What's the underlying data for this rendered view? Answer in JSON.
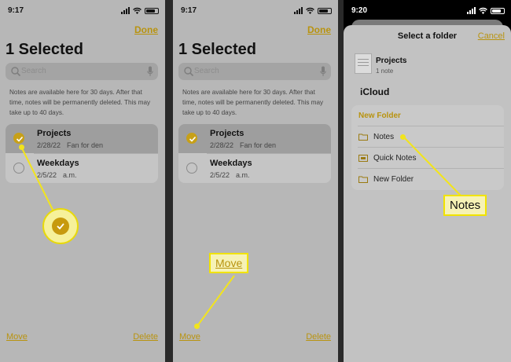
{
  "panel1": {
    "status_time": "9:17",
    "done_label": "Done",
    "title": "1 Selected",
    "search_placeholder": "Search",
    "info_text": "Notes are available here for 30 days. After that time, notes will be permanently deleted. This may take up to 40 days.",
    "notes": [
      {
        "title": "Projects",
        "date": "2/28/22",
        "preview": "Fan for den",
        "selected": true
      },
      {
        "title": "Weekdays",
        "date": "2/5/22",
        "preview": "a.m.",
        "selected": false
      }
    ],
    "move_label": "Move",
    "delete_label": "Delete"
  },
  "panel2": {
    "status_time": "9:17",
    "done_label": "Done",
    "title": "1 Selected",
    "search_placeholder": "Search",
    "info_text": "Notes are available here for 30 days. After that time, notes will be permanently deleted. This may take up to 40 days.",
    "notes": [
      {
        "title": "Projects",
        "date": "2/28/22",
        "preview": "Fan for den",
        "selected": true
      },
      {
        "title": "Weekdays",
        "date": "2/5/22",
        "preview": "a.m.",
        "selected": false
      }
    ],
    "move_label": "Move",
    "delete_label": "Delete",
    "callout": "Move"
  },
  "panel3": {
    "status_time": "9:20",
    "sheet_title": "Select a folder",
    "cancel_label": "Cancel",
    "selected_note_title": "Projects",
    "selected_note_count": "1 note",
    "account": "iCloud",
    "new_folder_heading": "New Folder",
    "folders": [
      "Notes",
      "Quick Notes",
      "New Folder"
    ],
    "callout": "Notes"
  },
  "colors": {
    "accent": "#b8930f",
    "callout_fill": "#f6f2b5",
    "callout_border": "#f1e300"
  }
}
